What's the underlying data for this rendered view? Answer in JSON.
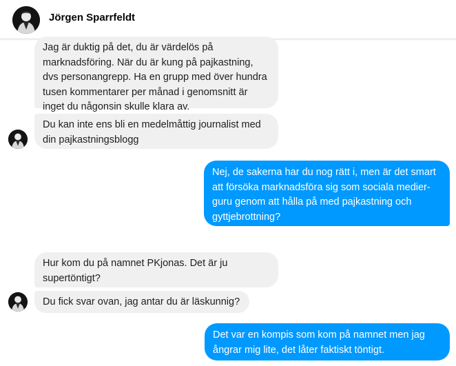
{
  "header": {
    "contact_name": "Jörgen Sparrfeldt",
    "avatar_icon": "user-avatar-photo"
  },
  "messages": [
    {
      "direction": "incoming",
      "text": "Jag är duktig på det, du är värdelös på marknadsföring. När du är kung på pajkastning, dvs personangrepp. Ha en grupp med över hundra tusen kommentarer per månad i genomsnitt är inget du någonsin skulle klara av."
    },
    {
      "direction": "incoming",
      "text": "Du kan inte ens bli en medelmåttig journalist med din pajkastningsblogg"
    },
    {
      "direction": "outgoing",
      "text": "Nej, de sakerna har du nog rätt i, men är det smart att försöka marknadsföra sig som sociala medier-guru genom att hålla på med pajkastning och gyttjebrottning?"
    },
    {
      "direction": "incoming",
      "text": "Hur kom du på namnet PKjonas. Det är ju supertöntigt?"
    },
    {
      "direction": "incoming",
      "text": "Du fick svar ovan, jag antar du är läskunnig?"
    },
    {
      "direction": "outgoing",
      "text": "Det var en kompis som kom på namnet men jag ångrar mig lite, det låter faktiskt töntigt."
    }
  ],
  "colors": {
    "incoming_bubble": "#f0f0f0",
    "outgoing_bubble": "#0099ff",
    "header_border": "#dddfe2"
  }
}
